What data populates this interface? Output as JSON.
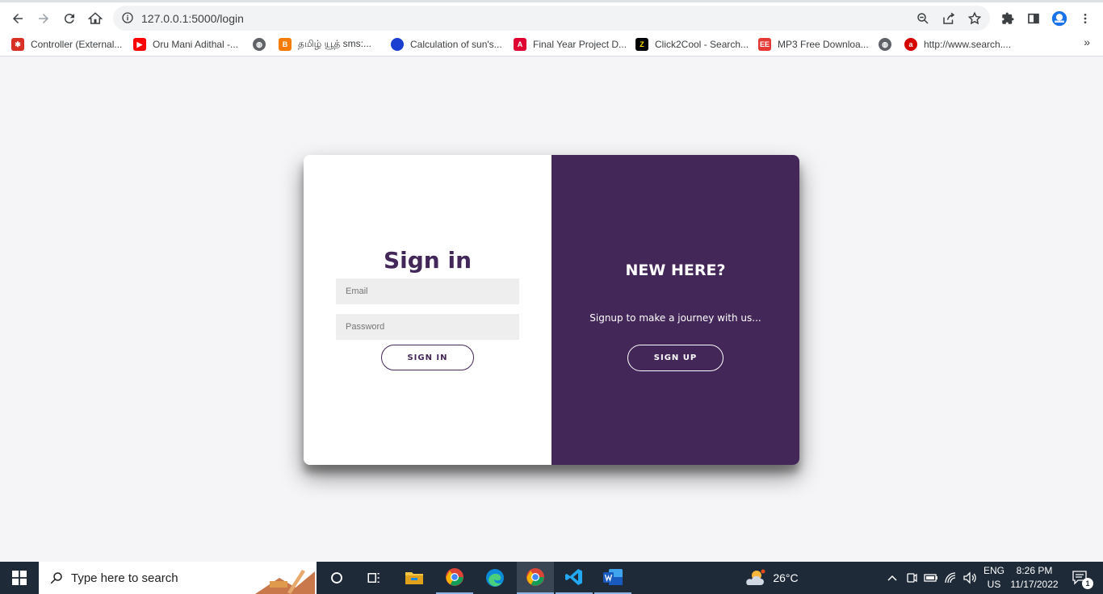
{
  "browser": {
    "url": "127.0.0.1:5000/login",
    "bookmarks": [
      {
        "label": "Controller (External...",
        "icon": "red-bug-icon",
        "color": "#d93025"
      },
      {
        "label": "Oru Mani Adithal -...",
        "icon": "youtube-icon",
        "color": "#ff0000"
      },
      {
        "label": "",
        "icon": "globe-icon",
        "color": "#5f6368"
      },
      {
        "label": "தமிழ் யூத் sms:...",
        "icon": "blogger-icon",
        "color": "#f57c00"
      },
      {
        "label": "Calculation of sun's...",
        "icon": "pie-icon",
        "color": "#1a3fd1"
      },
      {
        "label": "Final Year Project D...",
        "icon": "angular-icon",
        "color": "#dd0031"
      },
      {
        "label": "Click2Cool - Search...",
        "icon": "click2cool-icon",
        "color": "#000000"
      },
      {
        "label": "MP3 Free Downloa...",
        "icon": "mp3-icon",
        "color": "#e53935"
      },
      {
        "label": "",
        "icon": "globe-icon",
        "color": "#5f6368"
      },
      {
        "label": "http://www.search....",
        "icon": "ask-icon",
        "color": "#d50000"
      }
    ],
    "more": "»"
  },
  "login": {
    "title": "Sign in",
    "email_placeholder": "Email",
    "password_placeholder": "Password",
    "signin_button": "SIGN IN",
    "panel_title": "NEW HERE?",
    "panel_text": "Signup to make a journey with us...",
    "signup_button": "SIGN UP",
    "accent": "#432758"
  },
  "taskbar": {
    "search_placeholder": "Type here to search",
    "weather": "26°C",
    "language": "ENG",
    "region": "US",
    "time": "8:26 PM",
    "date": "11/17/2022",
    "notification_count": "1"
  }
}
